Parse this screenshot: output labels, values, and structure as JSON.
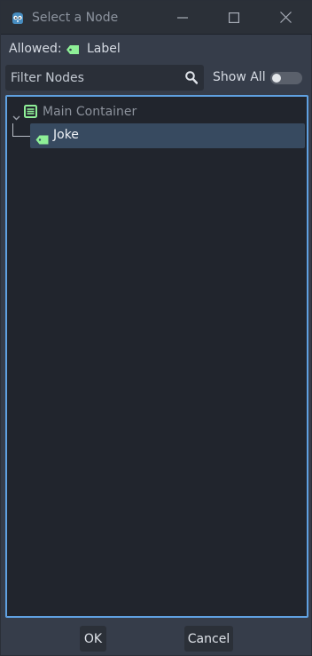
{
  "window": {
    "title": "Select a Node",
    "icons": {
      "app": "godot-icon",
      "minimize": "minimize-icon",
      "maximize": "maximize-icon",
      "close": "close-icon"
    }
  },
  "allowed": {
    "label": "Allowed:",
    "type_icon": "label-node-icon",
    "type": "Label"
  },
  "filter": {
    "placeholder": "Filter Nodes",
    "value": "",
    "icon": "search-icon"
  },
  "show_all": {
    "label": "Show All",
    "enabled": false
  },
  "tree": {
    "root": {
      "label": "Main Container",
      "icon": "container-icon",
      "expanded": true
    },
    "children": [
      {
        "label": "Joke",
        "icon": "label-node-icon",
        "selected": true
      }
    ]
  },
  "buttons": {
    "ok": "OK",
    "cancel": "Cancel"
  },
  "colors": {
    "accent": "#5fa0e0",
    "selection": "#374a60",
    "label_icon": "#8eef97",
    "container_icon": "#8eef97"
  }
}
